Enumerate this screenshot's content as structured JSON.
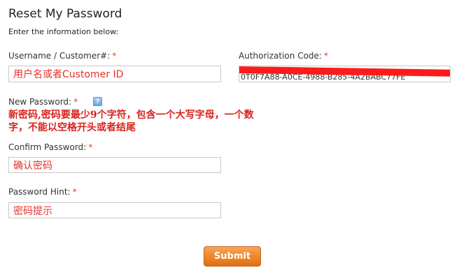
{
  "page": {
    "title": "Reset My Password",
    "intro": "Enter the information below:"
  },
  "form": {
    "required_marker": "*",
    "username": {
      "label": "Username / Customer#:",
      "value": "用户名或者Customer ID"
    },
    "auth_code": {
      "label": "Authorization Code:",
      "value": "0T0F7A88-A0CE-4988-B285-4A2BABC77FE",
      "redacted": true
    },
    "new_password": {
      "label": "New Password:",
      "help_icon": "help-question-icon",
      "help_symbol": "?",
      "value": ""
    },
    "password_note": "新密码,密码要最少9个字符，包含一个大写字母，一个数字，不能以空格开头或者结尾",
    "confirm_password": {
      "label": "Confirm Password:",
      "value": "确认密码"
    },
    "password_hint": {
      "label": "Password Hint:",
      "value": "密码提示"
    },
    "submit_label": "Submit"
  },
  "colors": {
    "required": "#e8401c",
    "annotation": "#d8231c",
    "submit": "#f08a2c"
  }
}
